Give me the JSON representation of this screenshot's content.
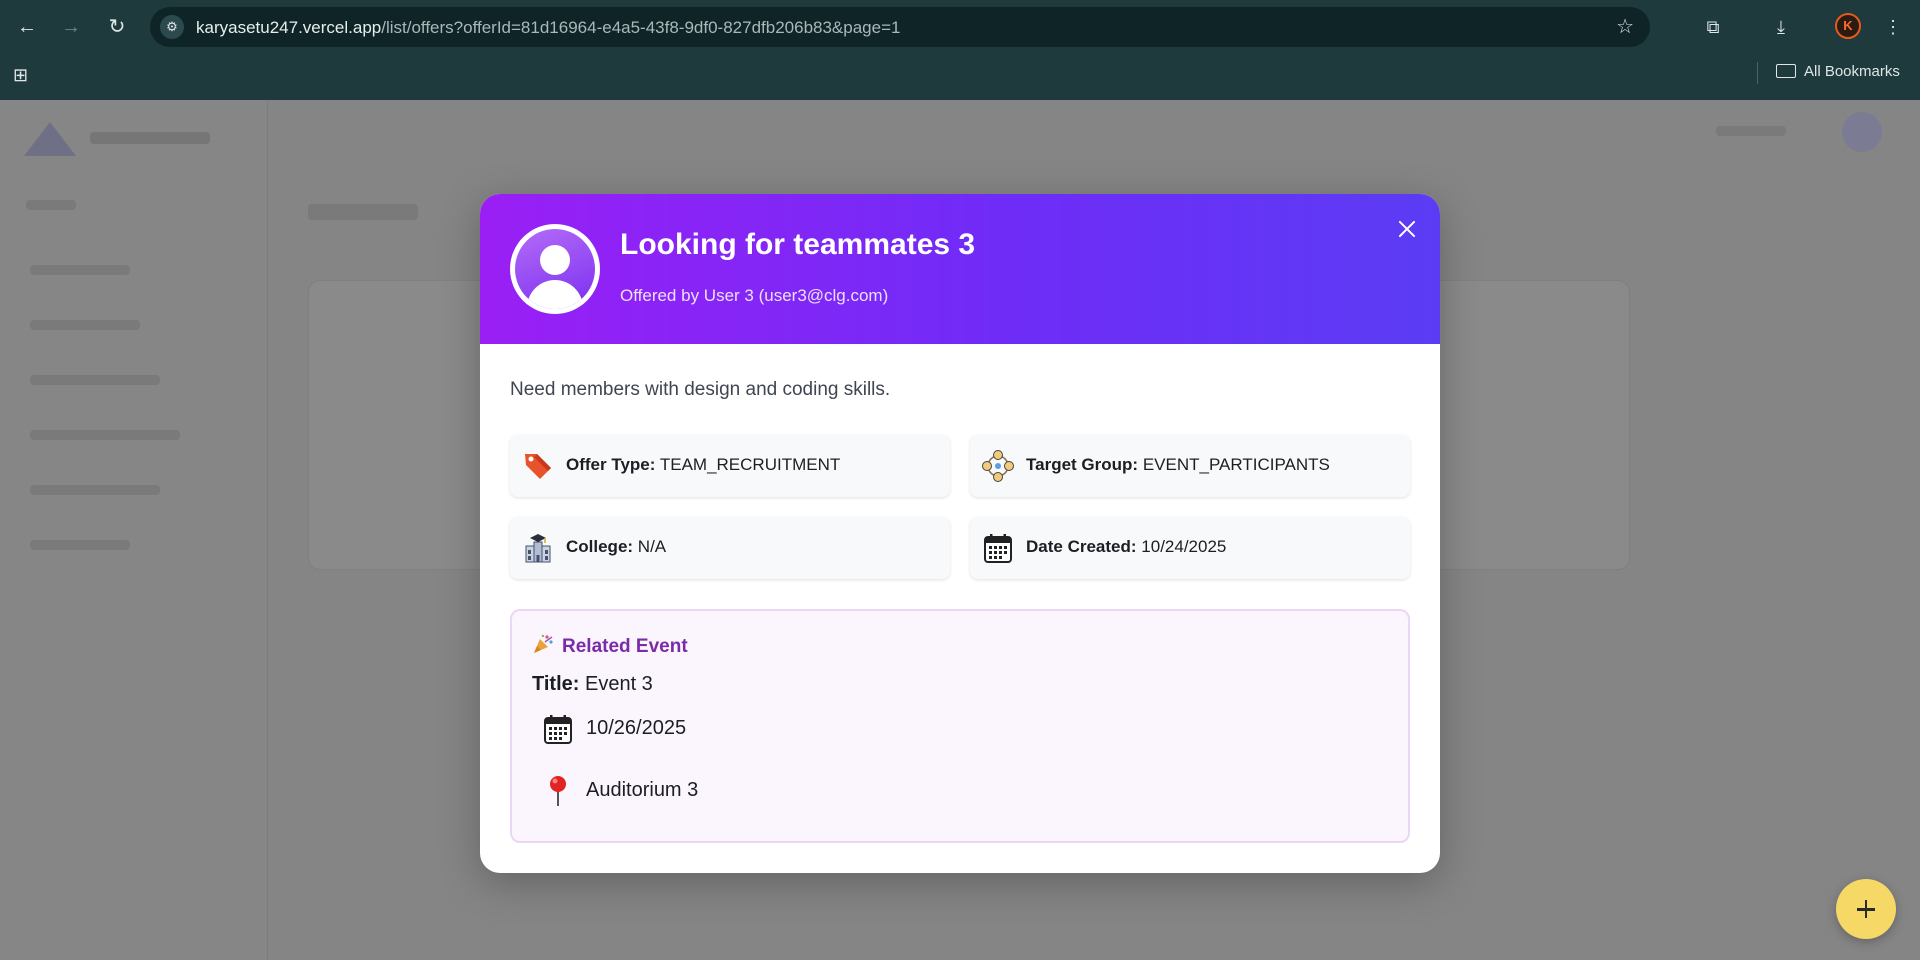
{
  "browser": {
    "url_host": "karyasetu247.vercel.app",
    "url_path": "/list/offers?offerId=81d16964-e4a5-43f8-9df0-827dfb206b83&page=1",
    "bookmarks_label": "All Bookmarks",
    "profile_initial": "K"
  },
  "modal": {
    "title": "Looking for teammates 3",
    "offered_by": "Offered by User 3 (user3@clg.com)",
    "description": "Need members with design and coding skills.",
    "details": [
      {
        "icon": "tag-icon",
        "label": "Offer Type:",
        "value": "TEAM_RECRUITMENT"
      },
      {
        "icon": "group-icon",
        "label": "Target Group:",
        "value": "EVENT_PARTICIPANTS"
      },
      {
        "icon": "college-icon",
        "label": "College:",
        "value": "N/A"
      },
      {
        "icon": "calendar-icon",
        "label": "Date Created:",
        "value": "10/24/2025"
      }
    ],
    "related_event": {
      "heading": "Related Event",
      "title_label": "Title:",
      "title_value": "Event 3",
      "date": "10/26/2025",
      "location": "Auditorium 3"
    }
  },
  "colors": {
    "header_gradient_start": "#9a1ff5",
    "header_gradient_end": "#5b3cf4",
    "event_heading": "#7a2ba8",
    "fab": "#f5d866"
  }
}
